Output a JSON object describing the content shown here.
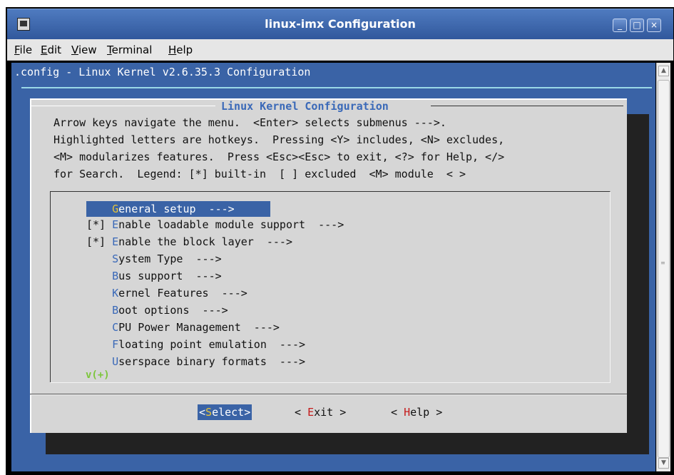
{
  "window": {
    "title": "linux-imx Configuration",
    "buttons": [
      "_",
      "□",
      "×"
    ]
  },
  "menubar": [
    {
      "hotkey": "F",
      "rest": "ile"
    },
    {
      "hotkey": "E",
      "rest": "dit"
    },
    {
      "hotkey": "V",
      "rest": "iew"
    },
    {
      "hotkey": "T",
      "rest": "erminal"
    },
    {
      "hotkey": "H",
      "rest": "elp"
    }
  ],
  "config_title": ".config - Linux Kernel v2.6.35.3 Configuration",
  "dialog": {
    "title": "Linux Kernel Configuration",
    "help_lines": [
      "Arrow keys navigate the menu.  <Enter> selects submenus --->.",
      "Highlighted letters are hotkeys.  Pressing <Y> includes, <N> excludes,",
      "<M> modularizes features.  Press <Esc><Esc> to exit, <?> for Help, </>",
      "for Search.  Legend: [*] built-in  [ ] excluded  <M> module  < >"
    ],
    "items": [
      {
        "prefix": "    ",
        "hotkey": "G",
        "rest": "eneral setup  --->",
        "selected": true
      },
      {
        "prefix": "[*] ",
        "hotkey": "E",
        "rest": "nable loadable module support  --->",
        "selected": false
      },
      {
        "prefix": "[*] ",
        "hotkey": "E",
        "rest": "nable the block layer  --->",
        "selected": false
      },
      {
        "prefix": "    ",
        "hotkey": "S",
        "rest": "ystem Type  --->",
        "selected": false
      },
      {
        "prefix": "    ",
        "hotkey": "B",
        "rest": "us support  --->",
        "selected": false
      },
      {
        "prefix": "    ",
        "hotkey": "K",
        "rest": "ernel Features  --->",
        "selected": false
      },
      {
        "prefix": "    ",
        "hotkey": "B",
        "rest": "oot options  --->",
        "selected": false
      },
      {
        "prefix": "    ",
        "hotkey": "C",
        "rest": "PU Power Management  --->",
        "selected": false
      },
      {
        "prefix": "    ",
        "hotkey": "F",
        "rest": "loating point emulation  --->",
        "selected": false
      },
      {
        "prefix": "    ",
        "hotkey": "U",
        "rest": "serspace binary formats  --->",
        "selected": false
      }
    ],
    "more_indicator": "v(+)",
    "buttons": {
      "select": {
        "open": "<",
        "hotkey": "S",
        "rest": "elect",
        "close": ">"
      },
      "exit": {
        "open": "< ",
        "hotkey": "E",
        "rest": "xit",
        "close": " >"
      },
      "help": {
        "open": "< ",
        "hotkey": "H",
        "rest": "elp",
        "close": " >"
      }
    }
  },
  "colors": {
    "terminal_bg": "#3a63a6",
    "dialog_bg": "#d6d6d6",
    "hotkey_blue": "#3a69b8",
    "hotkey_red": "#c41a1a",
    "selected_hotkey": "#e6c43a",
    "more_indicator": "#7cc63a"
  }
}
